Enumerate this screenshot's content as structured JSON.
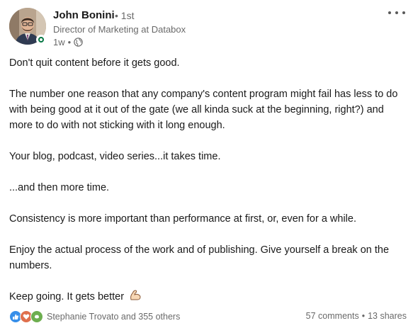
{
  "author": {
    "name": "John Bonini",
    "degree": "• 1st",
    "headline": "Director of Marketing at Databox",
    "time": "1w",
    "separator": "•"
  },
  "post": {
    "paragraphs": [
      "Don't quit content before it gets good.",
      "The number one reason that any company's content program might fail has less to do with being good at it out of the gate (we all kinda suck at the beginning, right?) and more to do with not sticking with it long enough.",
      "Your blog, podcast, video series...it takes time.",
      "...and then more time.",
      "Consistency is more important than performance at first, or, even for a while.",
      "Enjoy the actual process of the work and of publishing. Give yourself a break on the numbers.",
      "Keep going. It gets better"
    ],
    "emoji": "💪"
  },
  "social": {
    "reactors": "Stephanie Trovato and 355 others",
    "comments": "57 comments",
    "dot": "•",
    "shares": "13 shares",
    "reaction_icons": [
      "like-icon",
      "love-icon",
      "support-icon",
      "insightful-icon"
    ]
  },
  "colors": {
    "like": "#378fe9",
    "love": "#df704d",
    "support": "#6dae4f",
    "presence": "#057642"
  }
}
